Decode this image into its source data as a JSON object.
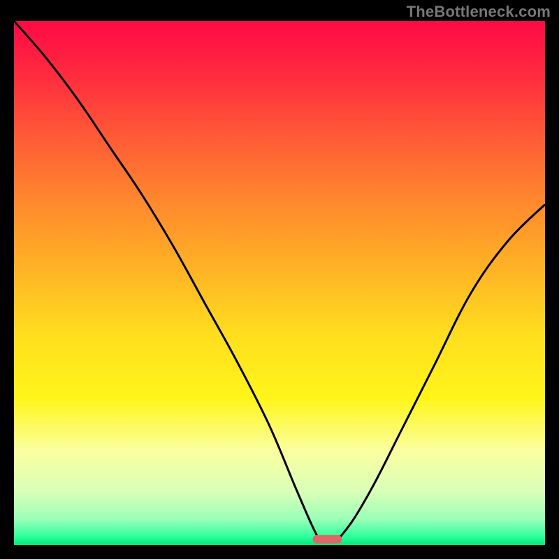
{
  "watermark": "TheBottleneck.com",
  "chart_data": {
    "type": "line",
    "title": "",
    "xlabel": "",
    "ylabel": "",
    "xlim": [
      0,
      100
    ],
    "ylim": [
      0,
      100
    ],
    "series": [
      {
        "name": "left-curve",
        "x": [
          0,
          6,
          12,
          18,
          24,
          30,
          36,
          42,
          48,
          53,
          56,
          57.5
        ],
        "values": [
          100,
          93,
          85,
          76,
          67,
          57,
          46,
          35,
          23,
          11,
          4,
          1
        ]
      },
      {
        "name": "right-curve",
        "x": [
          61,
          64,
          68,
          73,
          79,
          86,
          93,
          100
        ],
        "values": [
          1,
          5,
          12,
          22,
          34,
          48,
          58,
          65
        ]
      }
    ],
    "marker": {
      "x_center": 59,
      "y": 0.3,
      "width": 5.5,
      "height": 1.6,
      "color": "#e06666"
    },
    "gradient_stops": [
      {
        "offset": 0.0,
        "color": "#ff0945"
      },
      {
        "offset": 0.1,
        "color": "#ff2a3f"
      },
      {
        "offset": 0.22,
        "color": "#ff5a36"
      },
      {
        "offset": 0.35,
        "color": "#ff8a2d"
      },
      {
        "offset": 0.48,
        "color": "#ffb524"
      },
      {
        "offset": 0.6,
        "color": "#ffde1e"
      },
      {
        "offset": 0.72,
        "color": "#fff51a"
      },
      {
        "offset": 0.82,
        "color": "#fbffa0"
      },
      {
        "offset": 0.9,
        "color": "#d8ffb8"
      },
      {
        "offset": 0.95,
        "color": "#9cffb8"
      },
      {
        "offset": 0.985,
        "color": "#2cff9c"
      },
      {
        "offset": 1.0,
        "color": "#00e878"
      }
    ]
  }
}
